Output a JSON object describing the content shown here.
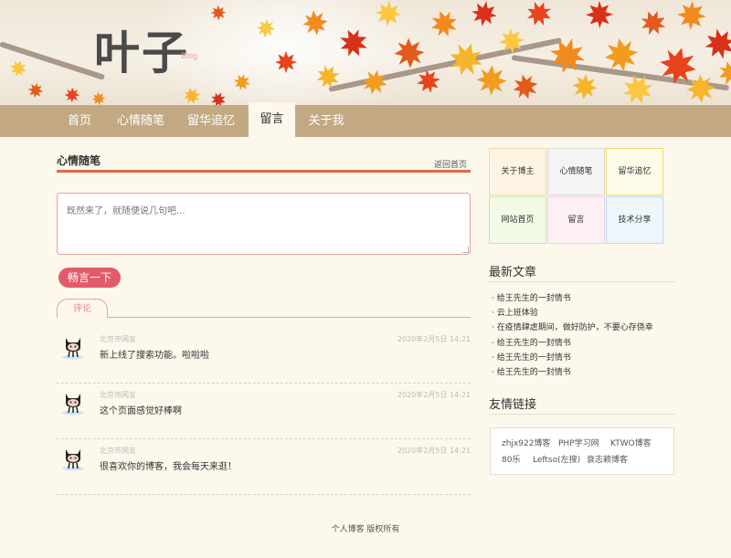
{
  "site": {
    "logo": "叶子",
    "logo_sub": "Blog"
  },
  "nav": [
    "首页",
    "心情随笔",
    "留华追忆",
    "留言",
    "关于我"
  ],
  "nav_active": "留言",
  "main": {
    "section_title": "心情随笔",
    "back_link": "返回首页",
    "message_placeholder": "既然来了，就随便说几句吧...",
    "submit_label": "畅言一下",
    "tab_label": "评论"
  },
  "comments": [
    {
      "user": "北京市网友",
      "time": "2020年2月5日 14:21",
      "text": "新上线了搜索功能。啦啦啦"
    },
    {
      "user": "北京市网友",
      "time": "2020年2月5日 14:21",
      "text": "这个页面感觉好棒啊"
    },
    {
      "user": "北京市网友",
      "time": "2020年2月5日 14:21",
      "text": "很喜欢你的博客，我会每天来逛！"
    }
  ],
  "sidebar": {
    "grid": [
      "关于博主",
      "心情随笔",
      "留华追忆",
      "网站首页",
      "留言",
      "技术分享"
    ],
    "latest_title": "最新文章",
    "articles": [
      "给王先生的一封情书",
      "云上班体验",
      "在疫情肆虐期间，做好防护，不要心存侥幸",
      "给王先生的一封情书",
      "给王先生的一封情书",
      "给王先生的一封情书"
    ],
    "links_title": "友情链接",
    "links": [
      "zhjx922博客",
      "PHP学习网",
      "KTWO博客",
      "80乐",
      "Leftso(左搜)",
      "衰志赖博客"
    ]
  },
  "footer": "个人博客 版权所有",
  "colors": {
    "nav_bg": "#c3a983",
    "accent": "#dd6b45",
    "button": "#e25b6a",
    "page_bg": "#fdf8ec"
  }
}
